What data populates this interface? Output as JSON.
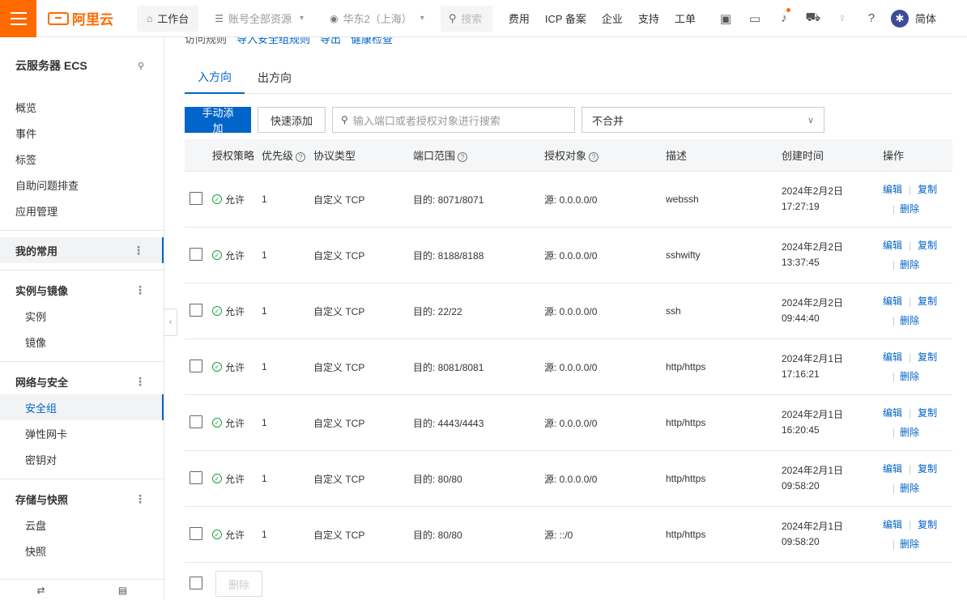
{
  "topbar": {
    "brand": "阿里云",
    "workbench": "工作台",
    "resources": "账号全部资源",
    "region": "华东2（上海）",
    "search_placeholder": "搜索",
    "links": [
      "费用",
      "ICP 备案",
      "企业",
      "支持",
      "工单"
    ],
    "lang": "简体"
  },
  "sidebar": {
    "title": "云服务器 ECS",
    "top_items": [
      "概览",
      "事件",
      "标签",
      "自助问题排查",
      "应用管理"
    ],
    "favorites": "我的常用",
    "group_instances": "实例与镜像",
    "instances_items": [
      "实例",
      "镜像"
    ],
    "group_network": "网络与安全",
    "network_items": [
      "安全组",
      "弹性网卡",
      "密钥对"
    ],
    "group_storage": "存储与快照",
    "storage_items": [
      "云盘",
      "快照"
    ]
  },
  "main": {
    "cutoff_links": [
      "访问规则",
      "导入安全组规则",
      "导出",
      "健康检查"
    ],
    "tabs": [
      "入方向",
      "出方向"
    ],
    "add_manual": "手动添加",
    "add_quick": "快速添加",
    "search_placeholder": "输入端口或者授权对象进行搜索",
    "merge_select": "不合并",
    "delete_button": "删除"
  },
  "table": {
    "headers": [
      "授权策略",
      "优先级",
      "协议类型",
      "端口范围",
      "授权对象",
      "描述",
      "创建时间",
      "操作"
    ],
    "op_edit": "编辑",
    "op_copy": "复制",
    "op_delete": "删除",
    "rows": [
      {
        "policy": "允许",
        "priority": "1",
        "protocol": "自定义 TCP",
        "port": "目的: 8071/8071",
        "source": "源: 0.0.0.0/0",
        "desc": "webssh",
        "date": "2024年2月2日",
        "time": "17:27:19"
      },
      {
        "policy": "允许",
        "priority": "1",
        "protocol": "自定义 TCP",
        "port": "目的: 8188/8188",
        "source": "源: 0.0.0.0/0",
        "desc": "sshwifty",
        "date": "2024年2月2日",
        "time": "13:37:45"
      },
      {
        "policy": "允许",
        "priority": "1",
        "protocol": "自定义 TCP",
        "port": "目的: 22/22",
        "source": "源: 0.0.0.0/0",
        "desc": "ssh",
        "date": "2024年2月2日",
        "time": "09:44:40"
      },
      {
        "policy": "允许",
        "priority": "1",
        "protocol": "自定义 TCP",
        "port": "目的: 8081/8081",
        "source": "源: 0.0.0.0/0",
        "desc": "http/https",
        "date": "2024年2月1日",
        "time": "17:16:21"
      },
      {
        "policy": "允许",
        "priority": "1",
        "protocol": "自定义 TCP",
        "port": "目的: 4443/4443",
        "source": "源: 0.0.0.0/0",
        "desc": "http/https",
        "date": "2024年2月1日",
        "time": "16:20:45"
      },
      {
        "policy": "允许",
        "priority": "1",
        "protocol": "自定义 TCP",
        "port": "目的: 80/80",
        "source": "源: 0.0.0.0/0",
        "desc": "http/https",
        "date": "2024年2月1日",
        "time": "09:58:20"
      },
      {
        "policy": "允许",
        "priority": "1",
        "protocol": "自定义 TCP",
        "port": "目的: 80/80",
        "source": "源: ::/0",
        "desc": "http/https",
        "date": "2024年2月1日",
        "time": "09:58:20"
      }
    ]
  },
  "colors": {
    "brand": "#ff6a00",
    "primary": "#0064c8",
    "success": "#1d9f3a"
  }
}
